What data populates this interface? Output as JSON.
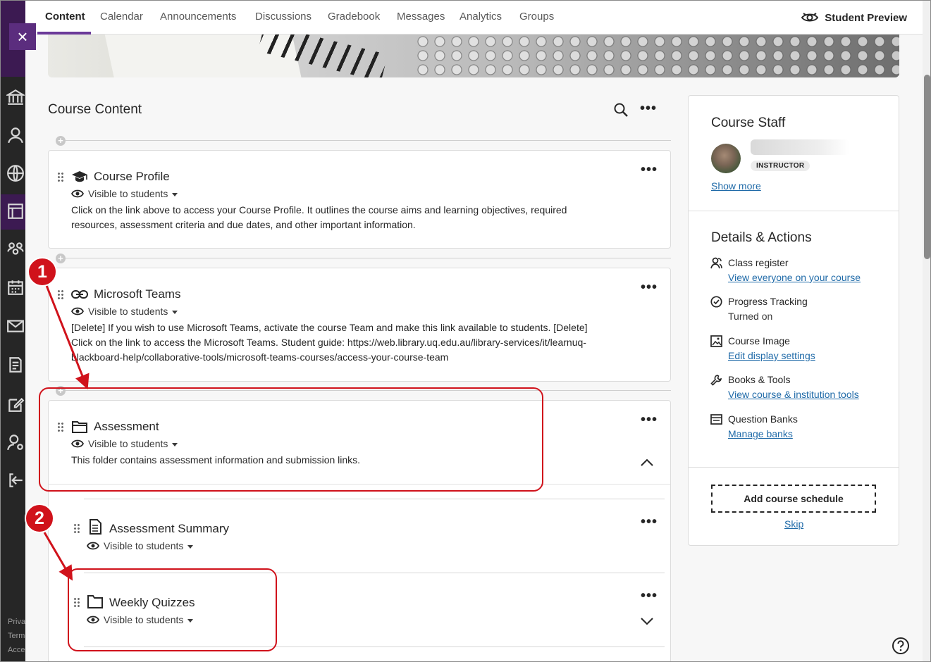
{
  "topnav": {
    "tabs": [
      "Content",
      "Calendar",
      "Announcements",
      "Discussions",
      "Gradebook",
      "Messages",
      "Analytics",
      "Groups"
    ],
    "active_tab": "Content",
    "student_preview": "Student Preview"
  },
  "sidebar": {
    "icons": [
      "close-icon",
      "institution-icon",
      "profile-icon",
      "globe-icon",
      "courses-icon",
      "groups-icon",
      "calendar-icon",
      "messages-icon",
      "grades-icon",
      "tools-icon",
      "user-admin-icon",
      "sign-out-icon"
    ],
    "footer": [
      "Priva",
      "Term",
      "Acce"
    ]
  },
  "course_content": {
    "title": "Course Content",
    "items": [
      {
        "title": "Course Profile",
        "icon": "graduation-cap-icon",
        "visibility": "Visible to students",
        "description_lines": [
          "Click on the link above to access your Course Profile. It outlines the course aims and learning objectives, required",
          "resources, assessment criteria and due dates, and other important information."
        ]
      },
      {
        "title": "Microsoft Teams",
        "icon": "link-icon",
        "visibility": "Visible to students",
        "description_lines": [
          "[Delete] If you wish to use Microsoft Teams, activate the course Team and make this link available to students. [Delete]",
          "Click on the link to access the Microsoft Teams. Student guide: https://web.library.uq.edu.au/library-services/it/learnuq-",
          "blackboard-help/collaborative-tools/microsoft-teams-courses/access-your-course-team"
        ]
      },
      {
        "title": "Assessment",
        "icon": "folder-open-icon",
        "visibility": "Visible to students",
        "description_lines": [
          "This folder contains assessment information and submission links."
        ]
      },
      {
        "title": "Assessment Summary",
        "icon": "document-icon",
        "visibility": "Visible to students",
        "description_lines": []
      },
      {
        "title": "Weekly Quizzes",
        "icon": "folder-icon",
        "visibility": "Visible to students",
        "description_lines": []
      }
    ]
  },
  "right_panel": {
    "staff_heading": "Course Staff",
    "instructor_role": "INSTRUCTOR",
    "show_more": "Show more",
    "details_heading": "Details & Actions",
    "details": [
      {
        "label": "Class register",
        "link": "View everyone on your course",
        "icon": "people-icon"
      },
      {
        "label": "Progress Tracking",
        "sub": "Turned on",
        "icon": "check-circle-icon"
      },
      {
        "label": "Course Image",
        "link": "Edit display settings",
        "icon": "image-icon"
      },
      {
        "label": "Books & Tools",
        "link": "View course & institution tools",
        "icon": "wrench-icon"
      },
      {
        "label": "Question Banks",
        "link": "Manage banks",
        "icon": "question-bank-icon"
      }
    ],
    "add_schedule": "Add course schedule",
    "skip": "Skip"
  },
  "annotations": {
    "callouts": [
      "1",
      "2"
    ],
    "color": "#d0121b"
  },
  "colors": {
    "accent": "#6b3a99",
    "sidebar": "#262626",
    "link": "#1f6aa8"
  }
}
